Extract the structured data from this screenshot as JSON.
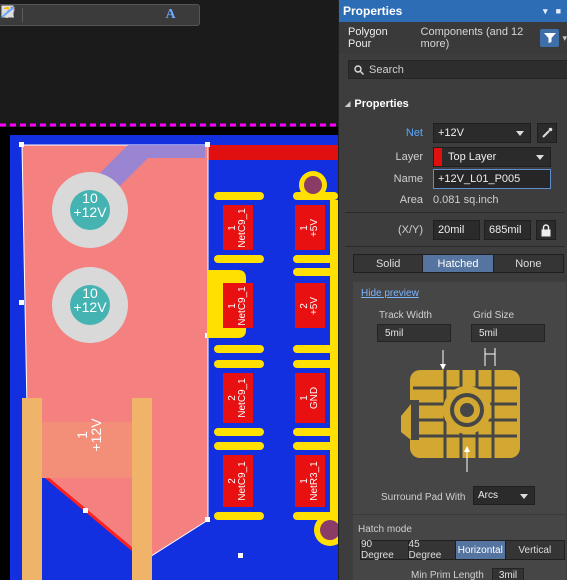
{
  "toolbar": {
    "tools": [
      "filter-icon",
      "place-icon",
      "route-icon",
      "interactive-route-icon",
      "pad-icon",
      "fill-icon",
      "rectangle-icon",
      "chart-icon",
      "text-icon",
      "line-icon"
    ]
  },
  "canvas": {
    "pads_circle": [
      {
        "line1": "10",
        "line2": "+12V"
      },
      {
        "line1": "10",
        "line2": "+12V"
      }
    ],
    "big_pad": {
      "line1": "1",
      "line2": "+12V"
    },
    "smd_pads": [
      {
        "n": "1",
        "net": "NetC9_1"
      },
      {
        "n": "1",
        "net": "NetC9_1"
      },
      {
        "n": "2",
        "net": "NetC9_1"
      },
      {
        "n": "2",
        "net": "NetC9_1"
      },
      {
        "n": "1",
        "net": "+5V"
      },
      {
        "n": "2",
        "net": "+5V"
      },
      {
        "n": "1",
        "net": "GND"
      },
      {
        "n": "1",
        "net": "NetR3_1"
      }
    ],
    "colors": {
      "board": "#1030e0",
      "pour": "#f48080",
      "track": "#ffe000",
      "pad": "#e81010",
      "keepout": "#ff00ff"
    }
  },
  "panel": {
    "title": "Properties",
    "kind": "Polygon Pour",
    "components": "Components (and 12 more)",
    "search_placeholder": "Search",
    "section": "Properties",
    "net_label": "Net",
    "net_value": "+12V",
    "layer_label": "Layer",
    "layer_value": "Top Layer",
    "name_label": "Name",
    "name_value": "+12V_L01_P005",
    "area_label": "Area",
    "area_value": "0.081 sq.inch",
    "xy_label": "(X/Y)",
    "x_value": "20mil",
    "y_value": "685mil",
    "fill_modes": [
      "Solid",
      "Hatched",
      "None"
    ],
    "fill_selected": "Hatched",
    "hide_preview": "Hide preview",
    "track_width_label": "Track Width",
    "track_width": "5mil",
    "grid_size_label": "Grid Size",
    "grid_size": "5mil",
    "surround_label": "Surround Pad With",
    "surround_value": "Arcs",
    "hatch_mode_label": "Hatch mode",
    "hatch_modes": [
      "90 Degree",
      "45 Degree",
      "Horizontal",
      "Vertical"
    ],
    "hatch_selected": "Horizontal",
    "min_prim_label": "Min Prim Length",
    "min_prim_value": "3mil"
  }
}
